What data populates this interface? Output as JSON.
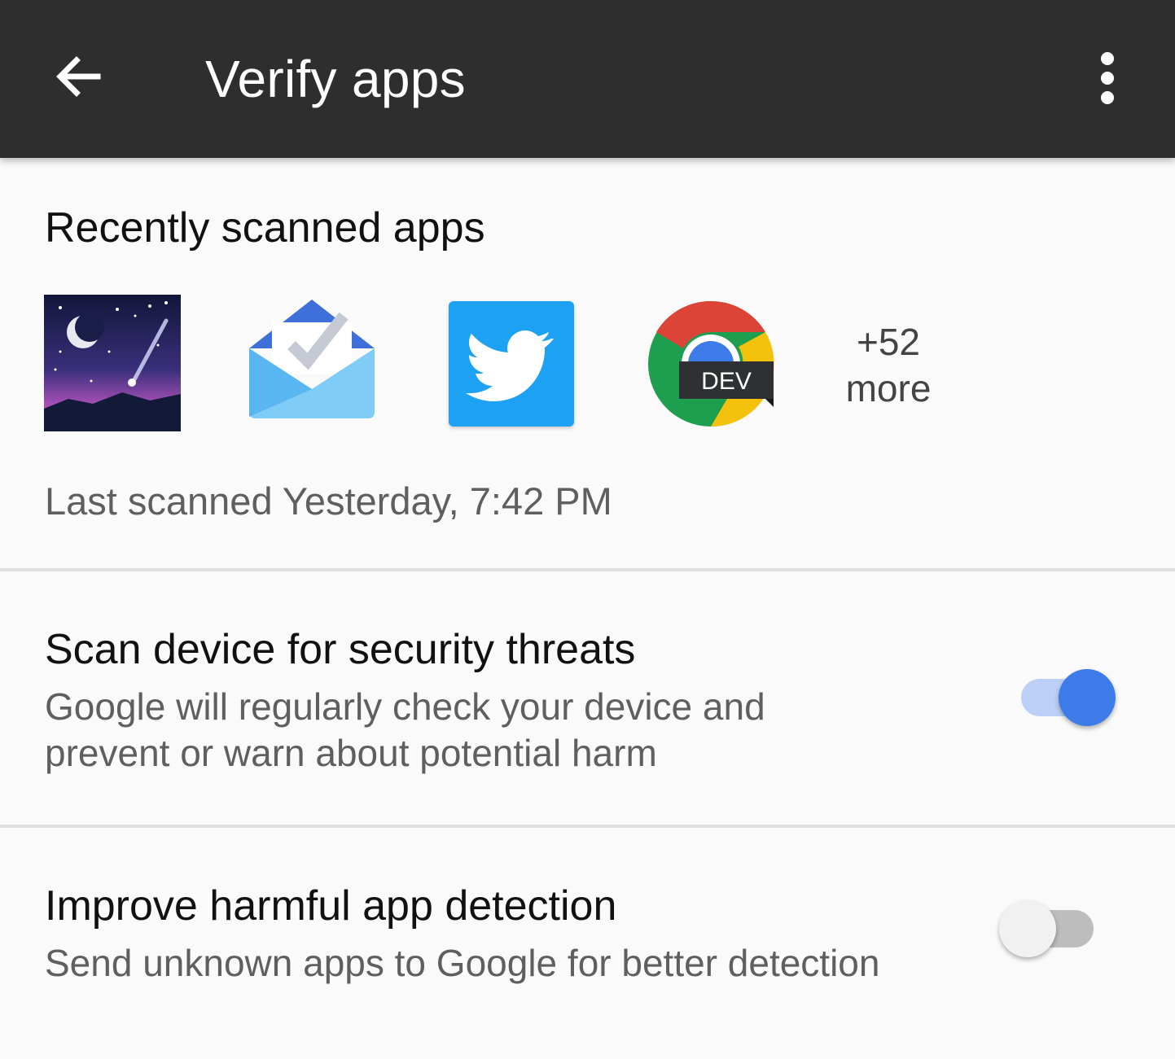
{
  "app_bar": {
    "title": "Verify apps",
    "back_icon": "arrow-back-icon",
    "overflow_icon": "more-vert-icon"
  },
  "recent": {
    "heading": "Recently scanned apps",
    "apps": [
      {
        "name": "starry-sky-app",
        "icon": "night-sky-icon"
      },
      {
        "name": "inbox-app",
        "icon": "inbox-envelope-check-icon"
      },
      {
        "name": "twitter-app",
        "icon": "twitter-bird-icon"
      },
      {
        "name": "chrome-dev-app",
        "icon": "chrome-dev-icon",
        "badge": "DEV"
      }
    ],
    "more_count": "+52",
    "more_word": "more",
    "last_scanned": "Last scanned Yesterday, 7:42 PM"
  },
  "settings": [
    {
      "title": "Scan device for security threats",
      "desc_line1": "Google will regularly check your device and",
      "desc_line2": "prevent or warn about potential harm",
      "enabled": true
    },
    {
      "title": "Improve harmful app detection",
      "desc_line1": "Send unknown apps to Google for better detection",
      "enabled": false
    }
  ],
  "colors": {
    "app_bar": "#2e2e2e",
    "accent": "#3d7be9",
    "accent_track": "#bcd0f7",
    "twitter_blue": "#1da1f2"
  }
}
